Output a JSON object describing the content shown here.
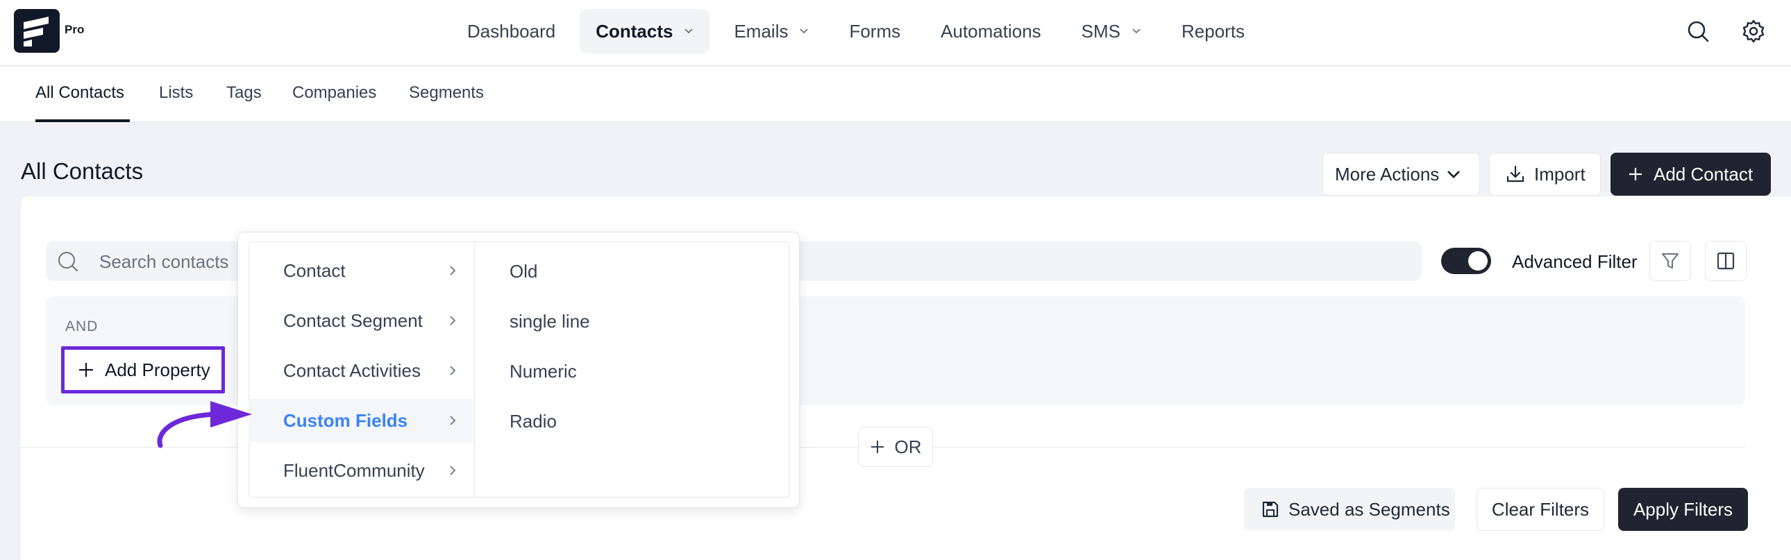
{
  "brand": {
    "logo_icon": "fluentcrm-logo-icon",
    "badge": "Pro"
  },
  "nav": {
    "items": [
      {
        "label": "Dashboard",
        "dropdown": false,
        "active": false
      },
      {
        "label": "Contacts",
        "dropdown": true,
        "active": true
      },
      {
        "label": "Emails",
        "dropdown": true,
        "active": false
      },
      {
        "label": "Forms",
        "dropdown": false,
        "active": false
      },
      {
        "label": "Automations",
        "dropdown": false,
        "active": false
      },
      {
        "label": "SMS",
        "dropdown": true,
        "active": false
      },
      {
        "label": "Reports",
        "dropdown": false,
        "active": false
      }
    ],
    "icons": [
      "search-icon",
      "gear-icon"
    ]
  },
  "subnav": {
    "tabs": [
      {
        "label": "All Contacts",
        "active": true
      },
      {
        "label": "Lists",
        "active": false
      },
      {
        "label": "Tags",
        "active": false
      },
      {
        "label": "Companies",
        "active": false
      },
      {
        "label": "Segments",
        "active": false
      }
    ]
  },
  "page": {
    "title": "All Contacts",
    "actions": {
      "more_actions": "More Actions",
      "import": "Import",
      "add_contact": "Add Contact"
    }
  },
  "filters": {
    "search_placeholder": "Search contacts",
    "advanced_filter_label": "Advanced Filter",
    "advanced_filter_enabled": true,
    "group_operator": "AND",
    "add_property": "Add Property",
    "or_label": "OR",
    "saved_as_segments": "Saved as Segments",
    "clear_filters": "Clear Filters",
    "apply_filters": "Apply Filters"
  },
  "property_menu": {
    "categories": [
      {
        "label": "Contact",
        "active": false
      },
      {
        "label": "Contact Segment",
        "active": false
      },
      {
        "label": "Contact Activities",
        "active": false
      },
      {
        "label": "Custom Fields",
        "active": true
      },
      {
        "label": "FluentCommunity",
        "active": false
      }
    ],
    "custom_fields": [
      "Old",
      "single line",
      "Numeric",
      "Radio"
    ]
  },
  "colors": {
    "dark": "#1f2430",
    "highlight_border": "#6d28d9",
    "active_menu_text": "#3b82f6",
    "page_bg": "#f1f2f8"
  }
}
